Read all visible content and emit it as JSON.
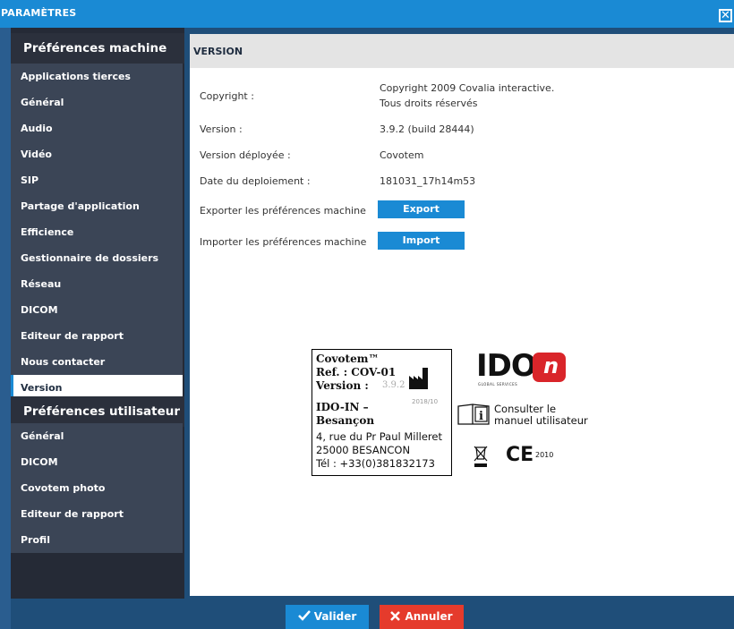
{
  "window": {
    "title": "PARAMÈTRES",
    "close_glyph": "✕"
  },
  "sidebar": {
    "machine_header": "Préférences machine",
    "machine_items": [
      "Applications tierces",
      "Général",
      "Audio",
      "Vidéo",
      "SIP",
      "Partage d'application",
      "Efficience",
      "Gestionnaire de dossiers",
      "Réseau",
      "DICOM",
      "Editeur de rapport",
      "Nous contacter",
      "Version"
    ],
    "active_item": "Version",
    "user_header": "Préférences utilisateur",
    "user_items": [
      "Général",
      "DICOM",
      "Covotem photo",
      "Editeur de rapport",
      "Profil"
    ]
  },
  "content": {
    "header": "VERSION",
    "copyright_label": "Copyright :",
    "copyright_value_1": "Copyright 2009 Covalia interactive.",
    "copyright_value_2": "Tous droits réservés",
    "version_label": "Version :",
    "version_value": "3.9.2 (build 28444)",
    "deployed_label": "Version déployée :",
    "deployed_value": "Covotem",
    "deploy_date_label": "Date du deploiement :",
    "deploy_date_value": "181031_17h14m53",
    "export_label": "Exporter les préférences machine",
    "export_button": "Export",
    "import_label": "Importer les préférences machine",
    "import_button": "Import"
  },
  "product_label": {
    "name": "Covotem™",
    "ref": "Ref. : COV-01",
    "version_prefix": "Version :",
    "version_value": "3.9.2",
    "manufacture_date": "2018/10",
    "company_1": "IDO-IN –",
    "company_2": "Besançon",
    "address_1": "4, rue du Pr Paul Milleret",
    "address_2": "25000 BESANCON",
    "phone": "Tél : +33(0)381832173"
  },
  "logo": {
    "text": "IDO",
    "subtitle": "GLOBAL SERVICES",
    "brand_color": "#d9252a"
  },
  "manual": {
    "line_1": "Consulter le",
    "line_2": "manuel utilisateur"
  },
  "ce": {
    "mark": "CE",
    "year": "2010"
  },
  "footer": {
    "ok_label": "Valider",
    "cancel_label": "Annuler"
  },
  "colors": {
    "accent": "#1a8ad4",
    "danger": "#e53b2c",
    "sidebar_dark": "#252a36",
    "sidebar_item": "#3b4556"
  }
}
